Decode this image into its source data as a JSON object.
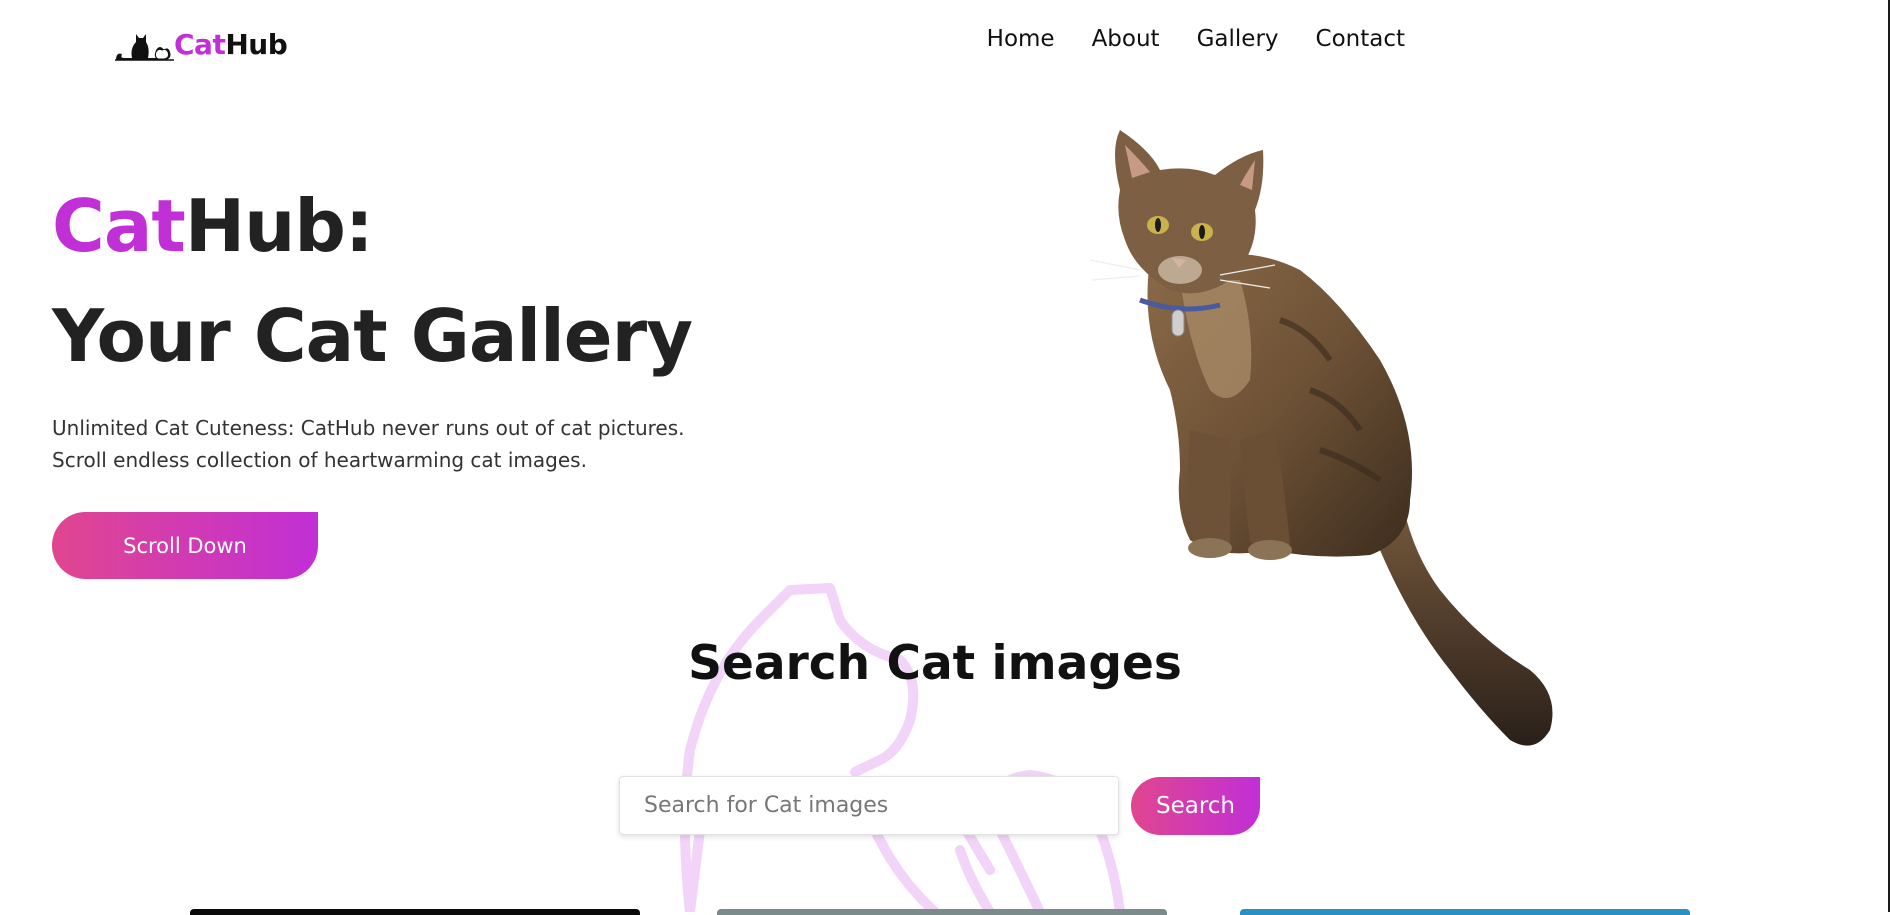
{
  "header": {
    "logo": {
      "part1": "Cat",
      "part2": "Hub",
      "icon": "cat-silhouette-icon"
    },
    "nav": [
      {
        "label": "Home"
      },
      {
        "label": "About"
      },
      {
        "label": "Gallery"
      },
      {
        "label": "Contact"
      }
    ]
  },
  "hero": {
    "title_accent": "Cat",
    "title_rest": "Hub:",
    "subtitle": "Your Cat Gallery",
    "description_line1": "Unlimited Cat Cuteness: CatHub never runs out of cat pictures.",
    "description_line2": "Scroll endless collection of heartwarming cat images.",
    "button_label": "Scroll Down",
    "image": "sitting-tabby-cat-photo"
  },
  "search": {
    "heading": "Search Cat images",
    "placeholder": "Search for Cat images",
    "value": "",
    "button_label": "Search"
  },
  "colors": {
    "accent": "#c12fd6",
    "gradient_start": "#e0468f",
    "gradient_end": "#c12fd6",
    "outline_decoration": "#f2d4f8"
  }
}
